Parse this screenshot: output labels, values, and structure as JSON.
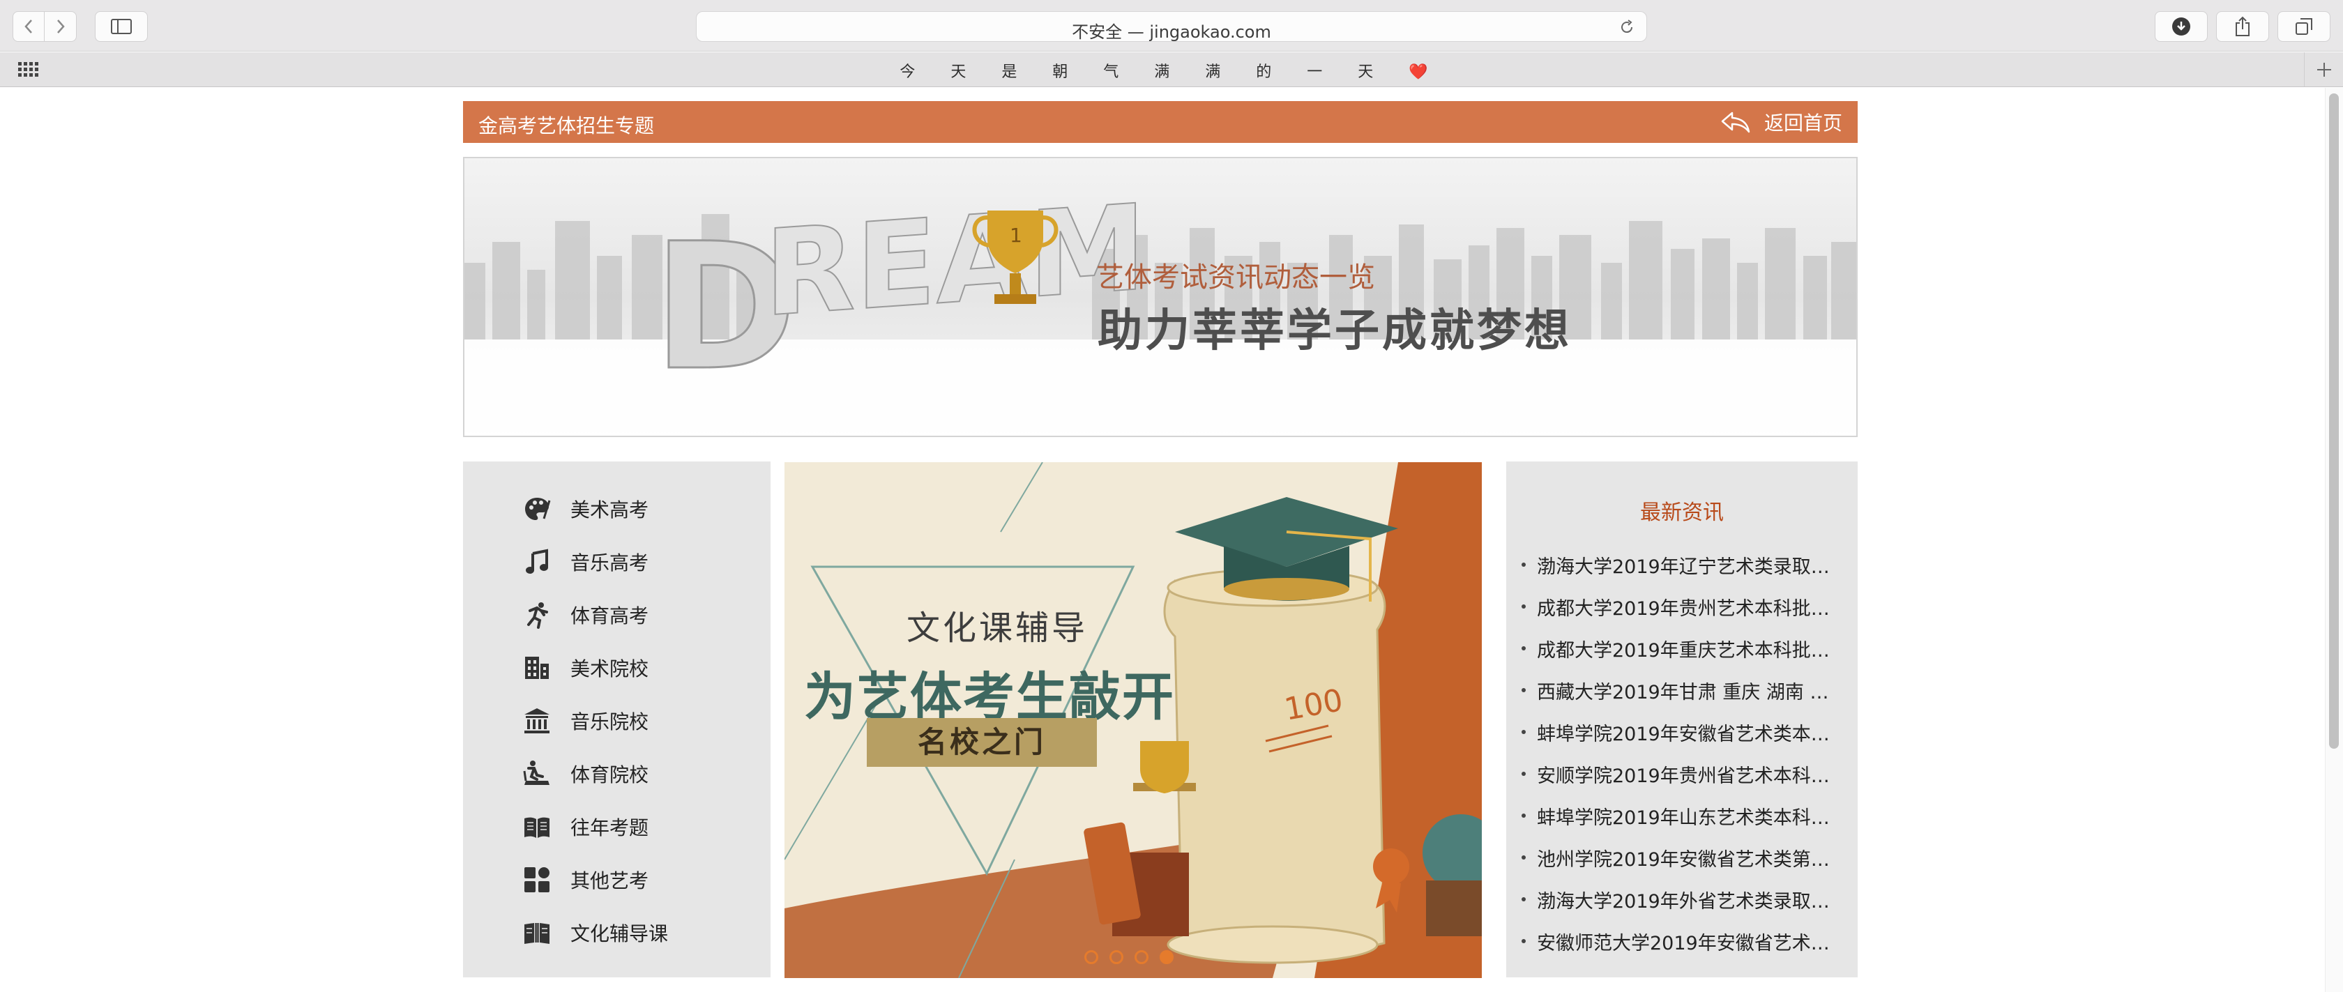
{
  "browser": {
    "url_text": "不安全 — jingaokao.com",
    "favorites_text": "今 天 是 朝 气 满 满 的 一 天 ❤️"
  },
  "header": {
    "title": "金高考艺体招生专题",
    "home_label": "返回首页"
  },
  "banner": {
    "subtitle": "艺体考试资讯动态一览",
    "headline": "助力莘莘学子成就梦想",
    "logo_text": "DREAM"
  },
  "nav": {
    "items": [
      {
        "label": "美术高考",
        "icon": "palette-icon"
      },
      {
        "label": "音乐高考",
        "icon": "music-note-icon"
      },
      {
        "label": "体育高考",
        "icon": "runner-icon"
      },
      {
        "label": "美术院校",
        "icon": "building-icon"
      },
      {
        "label": "音乐院校",
        "icon": "institution-icon"
      },
      {
        "label": "体育院校",
        "icon": "treadmill-icon"
      },
      {
        "label": "往年考题",
        "icon": "book-open-icon"
      },
      {
        "label": "其他艺考",
        "icon": "grid-icon"
      },
      {
        "label": "文化辅导课",
        "icon": "reading-book-icon"
      }
    ]
  },
  "slider": {
    "kicker": "文化课辅导",
    "headline": "为艺体考生敲开",
    "ribbon": "名校之门",
    "score": "100",
    "active_index": 3,
    "count": 4
  },
  "news": {
    "title": "最新资讯",
    "items": [
      "渤海大学2019年辽宁艺术类录取…",
      "成都大学2019年贵州艺术本科批…",
      "成都大学2019年重庆艺术本科批…",
      "西藏大学2019年甘肃 重庆 湖南 …",
      "蚌埠学院2019年安徽省艺术类本…",
      "安顺学院2019年贵州省艺术本科…",
      "蚌埠学院2019年山东艺术类本科…",
      "池州学院2019年安徽省艺术类第…",
      "渤海大学2019年外省艺术类录取…",
      "安徽师范大学2019年安徽省艺术…"
    ]
  },
  "colors": {
    "accent": "#d4764a",
    "news_title": "#b84a1a",
    "panel_bg": "#e6e6e6"
  }
}
